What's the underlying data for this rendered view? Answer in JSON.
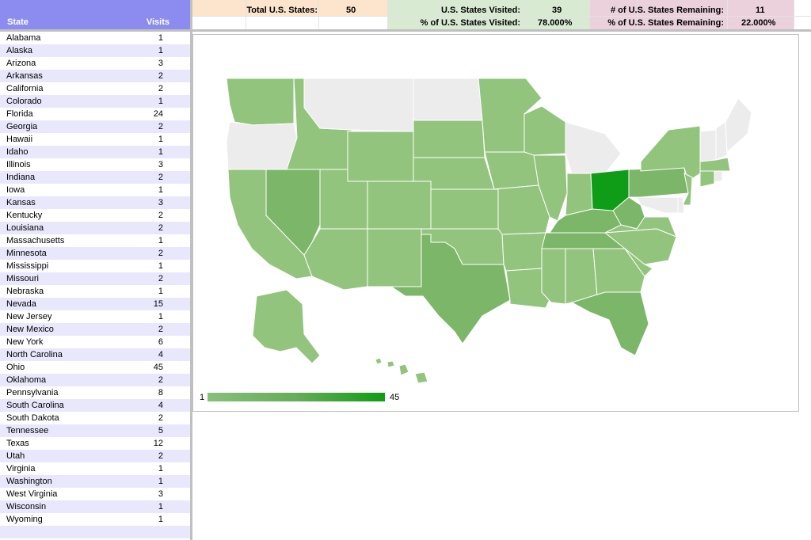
{
  "table": {
    "header": {
      "state": "State",
      "visits": "Visits"
    },
    "rows": [
      {
        "state": "Alabama",
        "visits": "1"
      },
      {
        "state": "Alaska",
        "visits": "1"
      },
      {
        "state": "Arizona",
        "visits": "3"
      },
      {
        "state": "Arkansas",
        "visits": "2"
      },
      {
        "state": "California",
        "visits": "2"
      },
      {
        "state": "Colorado",
        "visits": "1"
      },
      {
        "state": "Florida",
        "visits": "24"
      },
      {
        "state": "Georgia",
        "visits": "2"
      },
      {
        "state": "Hawaii",
        "visits": "1"
      },
      {
        "state": "Idaho",
        "visits": "1"
      },
      {
        "state": "Illinois",
        "visits": "3"
      },
      {
        "state": "Indiana",
        "visits": "2"
      },
      {
        "state": "Iowa",
        "visits": "1"
      },
      {
        "state": "Kansas",
        "visits": "3"
      },
      {
        "state": "Kentucky",
        "visits": "2"
      },
      {
        "state": "Louisiana",
        "visits": "2"
      },
      {
        "state": "Massachusetts",
        "visits": "1"
      },
      {
        "state": "Minnesota",
        "visits": "2"
      },
      {
        "state": "Mississippi",
        "visits": "1"
      },
      {
        "state": "Missouri",
        "visits": "2"
      },
      {
        "state": "Nebraska",
        "visits": "1"
      },
      {
        "state": "Nevada",
        "visits": "15"
      },
      {
        "state": "New Jersey",
        "visits": "1"
      },
      {
        "state": "New Mexico",
        "visits": "2"
      },
      {
        "state": "New York",
        "visits": "6"
      },
      {
        "state": "North Carolina",
        "visits": "4"
      },
      {
        "state": "Ohio",
        "visits": "45"
      },
      {
        "state": "Oklahoma",
        "visits": "2"
      },
      {
        "state": "Pennsylvania",
        "visits": "8"
      },
      {
        "state": "South Carolina",
        "visits": "4"
      },
      {
        "state": "South Dakota",
        "visits": "2"
      },
      {
        "state": "Tennessee",
        "visits": "5"
      },
      {
        "state": "Texas",
        "visits": "12"
      },
      {
        "state": "Utah",
        "visits": "2"
      },
      {
        "state": "Virginia",
        "visits": "1"
      },
      {
        "state": "Washington",
        "visits": "1"
      },
      {
        "state": "West Virginia",
        "visits": "3"
      },
      {
        "state": "Wisconsin",
        "visits": "1"
      },
      {
        "state": "Wyoming",
        "visits": "1"
      },
      {
        "state": "",
        "visits": ""
      }
    ]
  },
  "summary": {
    "total_label": "Total U.S. States:",
    "total_value": "50",
    "visited_label": "U.S. States Visited:",
    "visited_value": "39",
    "visited_pct_label": "% of U.S. States Visited:",
    "visited_pct_value": "78.000%",
    "remaining_label": "# of U.S. States Remaining:",
    "remaining_value": "11",
    "remaining_pct_label": "% of U.S. States Remaining:",
    "remaining_pct_value": "22.000%"
  },
  "map": {
    "legend_min": "1",
    "legend_max": "45",
    "colors": {
      "unvisited": "#ececec",
      "low": "#93c47d",
      "mid": "#7cb668",
      "high": "#0f9d17",
      "border": "#ffffff"
    }
  }
}
